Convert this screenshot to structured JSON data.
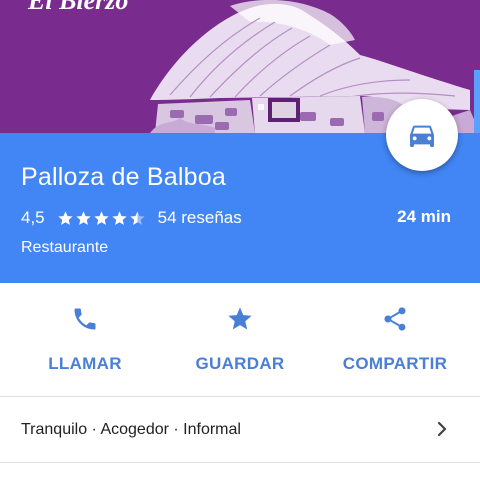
{
  "header": {
    "brand_text": "El Bierzo",
    "background_color": "#7a2c8e"
  },
  "place": {
    "name": "Palloza de Balboa",
    "rating": "4,5",
    "stars_value": 4.5,
    "stars_max": 5,
    "reviews": "54 reseñas",
    "drive_time": "24 min",
    "category": "Restaurante",
    "panel_color": "#4285f4"
  },
  "directions_button": {
    "icon": "car-icon"
  },
  "actions": [
    {
      "label": "LLAMAR",
      "icon": "phone-icon"
    },
    {
      "label": "GUARDAR",
      "icon": "star-icon"
    },
    {
      "label": "COMPARTIR",
      "icon": "share-icon"
    }
  ],
  "attributes": {
    "text": "Tranquilo · Acogedor · Informal",
    "icon": "chevron-right-icon"
  },
  "accent_color": "#4a7fd6"
}
